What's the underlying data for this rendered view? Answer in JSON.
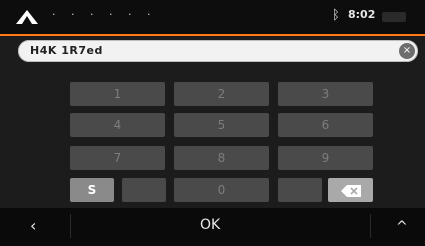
{
  "status": {
    "title": "· · · · · ·",
    "bluetooth_icon": "bluetooth-icon",
    "time": "8:02"
  },
  "input": {
    "value": "H4K 1R7ed"
  },
  "keypad": {
    "row1": [
      "1",
      "2",
      "3"
    ],
    "row2": [
      "4",
      "5",
      "6"
    ],
    "row3": [
      "7",
      "8",
      "9"
    ],
    "shift_label": "S",
    "space_label": "0",
    "backspace_icon": "backspace-icon"
  },
  "bottom": {
    "back_label": "‹",
    "ok_label": "OK",
    "up_label": "^"
  },
  "colors": {
    "accent": "#ff7a14",
    "key_bg": "#4a4a4a",
    "shift_bg": "#8a8a8a",
    "backspace_bg": "#a9a9a9"
  }
}
